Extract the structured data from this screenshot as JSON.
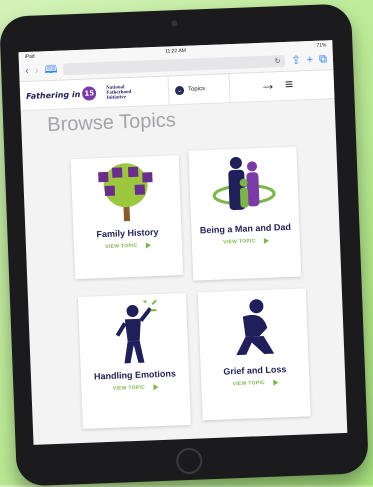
{
  "status_bar": {
    "carrier": "iPad",
    "time": "11:22 AM",
    "battery": "71%"
  },
  "browser": {
    "reload_icon": "reload-icon",
    "share_icon": "share-icon",
    "new_tab_icon": "plus-icon",
    "tabs_icon": "tabs-icon"
  },
  "site_nav": {
    "logo_text": "Fathering in",
    "logo_number": "15",
    "partner_logo": "National Fatherhood Initiative",
    "topics_label": "Topics"
  },
  "page": {
    "heading": "Browse Topics"
  },
  "cards": [
    {
      "title": "Family History",
      "link": "VIEW TOPIC",
      "icon": "family-tree-icon"
    },
    {
      "title": "Being a Man and Dad",
      "link": "VIEW TOPIC",
      "icon": "father-child-icon"
    },
    {
      "title": "Handling Emotions",
      "link": "VIEW TOPIC",
      "icon": "emotions-figure-icon"
    },
    {
      "title": "Grief and Loss",
      "link": "VIEW TOPIC",
      "icon": "kneeling-figure-icon"
    }
  ],
  "colors": {
    "brand_navy": "#1f1f5c",
    "accent_green": "#7ab648",
    "accent_purple": "#7c3aa8"
  }
}
